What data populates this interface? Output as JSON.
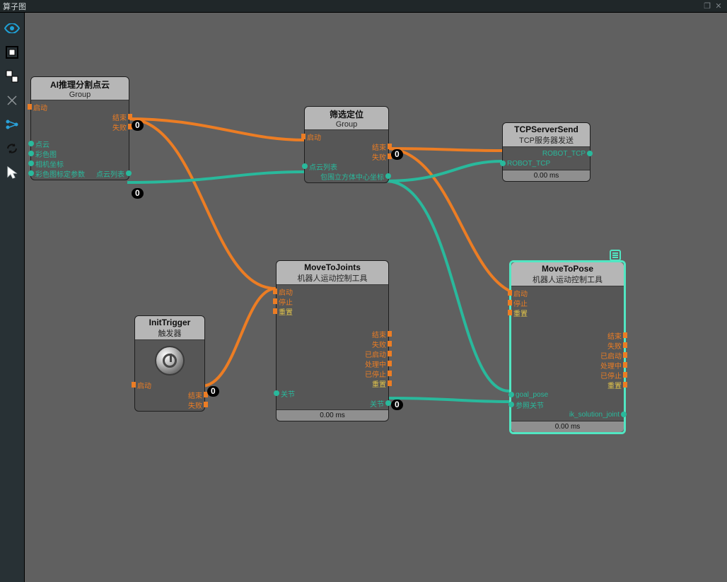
{
  "window": {
    "title": "算子图"
  },
  "toolbar_icons": [
    "eye",
    "group-box",
    "node-box",
    "snap",
    "graph",
    "refresh",
    "cursor"
  ],
  "nodes": {
    "ai": {
      "title": "AI推理分割点云",
      "subtitle": "Group",
      "inputs_exec": [
        "启动"
      ],
      "inputs_data": [
        "点云",
        "彩色图",
        "相机坐标",
        "彩色图标定参数"
      ],
      "outputs_exec": [
        "结束",
        "失败"
      ],
      "outputs_data": [
        "点云列表"
      ]
    },
    "filter": {
      "title": "筛选定位",
      "subtitle": "Group",
      "inputs_exec": [
        "启动"
      ],
      "inputs_data": [
        "点云列表"
      ],
      "outputs_exec": [
        "结束",
        "失败"
      ],
      "outputs_data": [
        "包围立方体中心坐标"
      ]
    },
    "tcp": {
      "title": "TCPServerSend",
      "subtitle": "TCP服务器发送",
      "inputs_data": [
        "ROBOT_TCP"
      ],
      "outputs_data": [
        "ROBOT_TCP"
      ],
      "footer": "0.00 ms"
    },
    "trigger": {
      "title": "InitTrigger",
      "subtitle": "触发器",
      "inputs_exec": [
        "启动"
      ],
      "outputs_exec": [
        "结束",
        "失败"
      ]
    },
    "movejoints": {
      "title": "MoveToJoints",
      "subtitle": "机器人运动控制工具",
      "inputs_exec": [
        "启动",
        "停止",
        "重置"
      ],
      "inputs_data": [
        "关节"
      ],
      "outputs_exec": [
        "结束",
        "失败",
        "已启动",
        "处理中",
        "已停止"
      ],
      "outputs_reset": [
        "重置"
      ],
      "outputs_data": [
        "关节"
      ],
      "footer": "0.00 ms"
    },
    "movepose": {
      "title": "MoveToPose",
      "subtitle": "机器人运动控制工具",
      "inputs_exec": [
        "启动",
        "停止",
        "重置"
      ],
      "inputs_data": [
        "goal_pose",
        "参照关节"
      ],
      "outputs_exec": [
        "结束",
        "失败",
        "已启动",
        "处理中",
        "已停止"
      ],
      "outputs_reset": [
        "重置"
      ],
      "outputs_data": [
        "ik_solution_joint"
      ],
      "footer": "0.00 ms"
    }
  },
  "badges": {
    "zero": "0"
  }
}
